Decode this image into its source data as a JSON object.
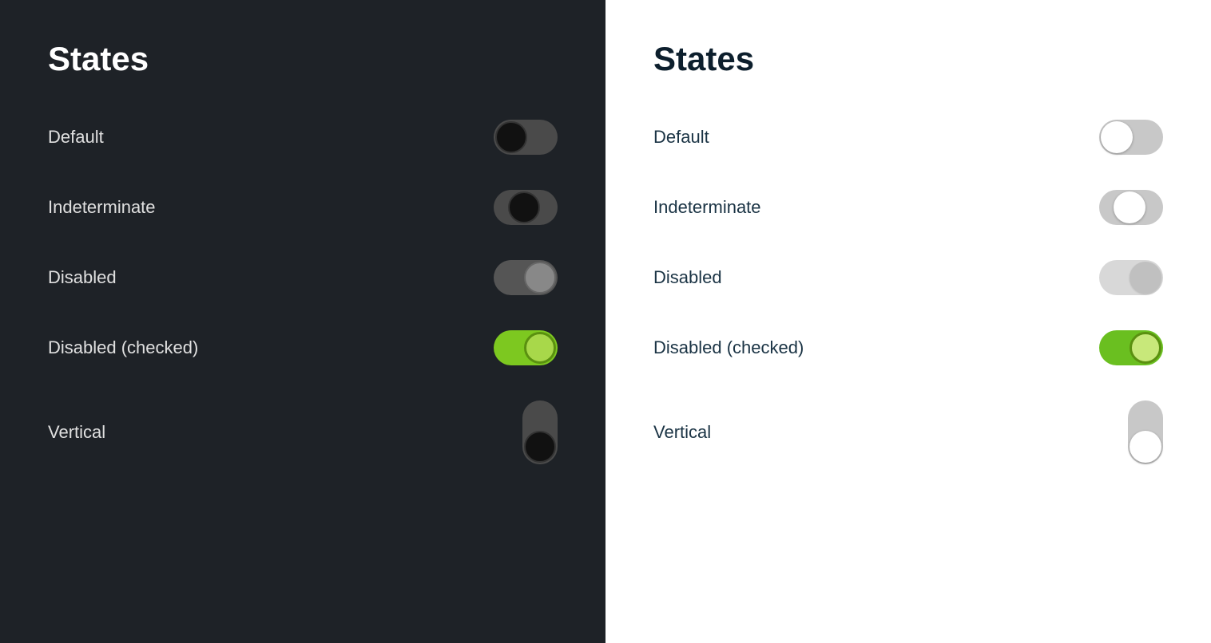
{
  "dark_panel": {
    "title": "States",
    "states": [
      {
        "id": "default",
        "label": "Default"
      },
      {
        "id": "indeterminate",
        "label": "Indeterminate"
      },
      {
        "id": "disabled",
        "label": "Disabled"
      },
      {
        "id": "disabled-checked",
        "label": "Disabled (checked)"
      },
      {
        "id": "vertical",
        "label": "Vertical"
      }
    ]
  },
  "light_panel": {
    "title": "States",
    "states": [
      {
        "id": "default",
        "label": "Default"
      },
      {
        "id": "indeterminate",
        "label": "Indeterminate"
      },
      {
        "id": "disabled",
        "label": "Disabled"
      },
      {
        "id": "disabled-checked",
        "label": "Disabled (checked)"
      },
      {
        "id": "vertical",
        "label": "Vertical"
      }
    ]
  }
}
